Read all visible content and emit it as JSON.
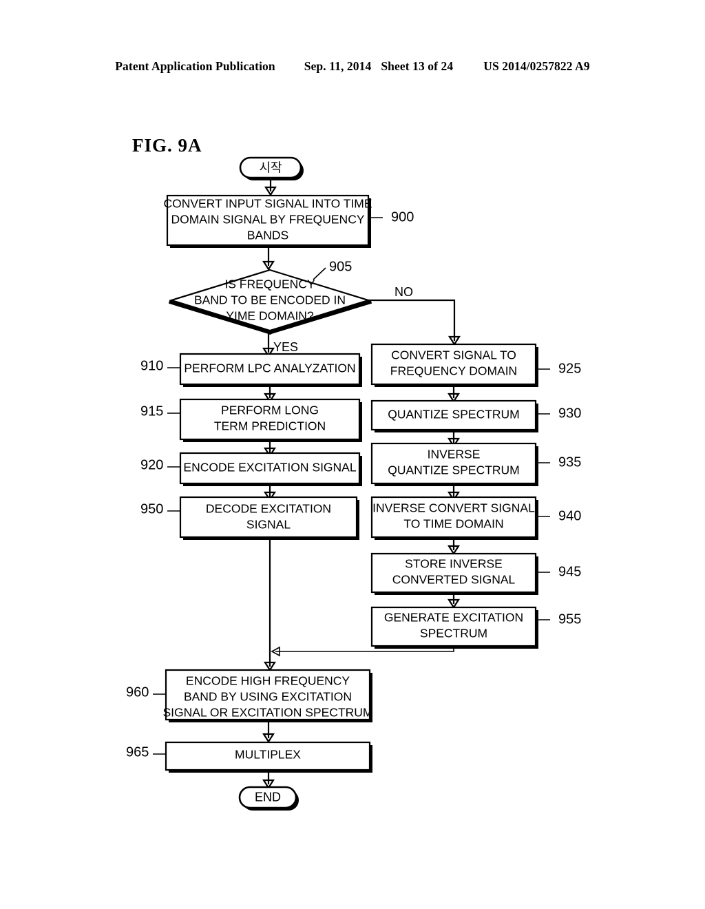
{
  "header": {
    "publication": "Patent Application Publication",
    "date": "Sep. 11, 2014",
    "sheet": "Sheet 13 of 24",
    "number": "US 2014/0257822 A9"
  },
  "figure": {
    "label": "FIG.  9A"
  },
  "flowchart": {
    "start_label": "시작",
    "end_label": "END",
    "branch_yes": "YES",
    "branch_no": "NO",
    "nodes": [
      {
        "ref": "900",
        "type": "process",
        "lines": [
          "CONVERT INPUT SIGNAL INTO TIME",
          "DOMAIN SIGNAL BY FREQUENCY",
          "BANDS"
        ]
      },
      {
        "ref": "905",
        "type": "decision",
        "lines": [
          "IS FREQUENCY",
          "BAND TO BE ENCODED IN",
          "YIME DOMAIN?"
        ]
      },
      {
        "ref": "910",
        "type": "process",
        "lines": [
          "PERFORM LPC ANALYZATION"
        ]
      },
      {
        "ref": "915",
        "type": "process",
        "lines": [
          "PERFORM LONG",
          "TERM PREDICTION"
        ]
      },
      {
        "ref": "920",
        "type": "process",
        "lines": [
          "ENCODE EXCITATION SIGNAL"
        ]
      },
      {
        "ref": "950",
        "type": "process",
        "lines": [
          "DECODE EXCITATION",
          "SIGNAL"
        ]
      },
      {
        "ref": "925",
        "type": "process",
        "lines": [
          "CONVERT SIGNAL TO",
          "FREQUENCY DOMAIN"
        ]
      },
      {
        "ref": "930",
        "type": "process",
        "lines": [
          "QUANTIZE SPECTRUM"
        ]
      },
      {
        "ref": "935",
        "type": "process",
        "lines": [
          "INVERSE",
          "QUANTIZE SPECTRUM"
        ]
      },
      {
        "ref": "940",
        "type": "process",
        "lines": [
          "INVERSE CONVERT SIGNAL",
          "TO TIME DOMAIN"
        ]
      },
      {
        "ref": "945",
        "type": "process",
        "lines": [
          "STORE INVERSE",
          "CONVERTED SIGNAL"
        ]
      },
      {
        "ref": "955",
        "type": "process",
        "lines": [
          "GENERATE EXCITATION",
          "SPECTRUM"
        ]
      },
      {
        "ref": "960",
        "type": "process",
        "lines": [
          "ENCODE HIGH FREQUENCY",
          "BAND BY USING EXCITATION",
          "SIGNAL OR EXCITATION SPECTRUM"
        ]
      },
      {
        "ref": "965",
        "type": "process",
        "lines": [
          "MULTIPLEX"
        ]
      }
    ]
  },
  "colors": {
    "ink": "#000000",
    "paper": "#ffffff"
  }
}
